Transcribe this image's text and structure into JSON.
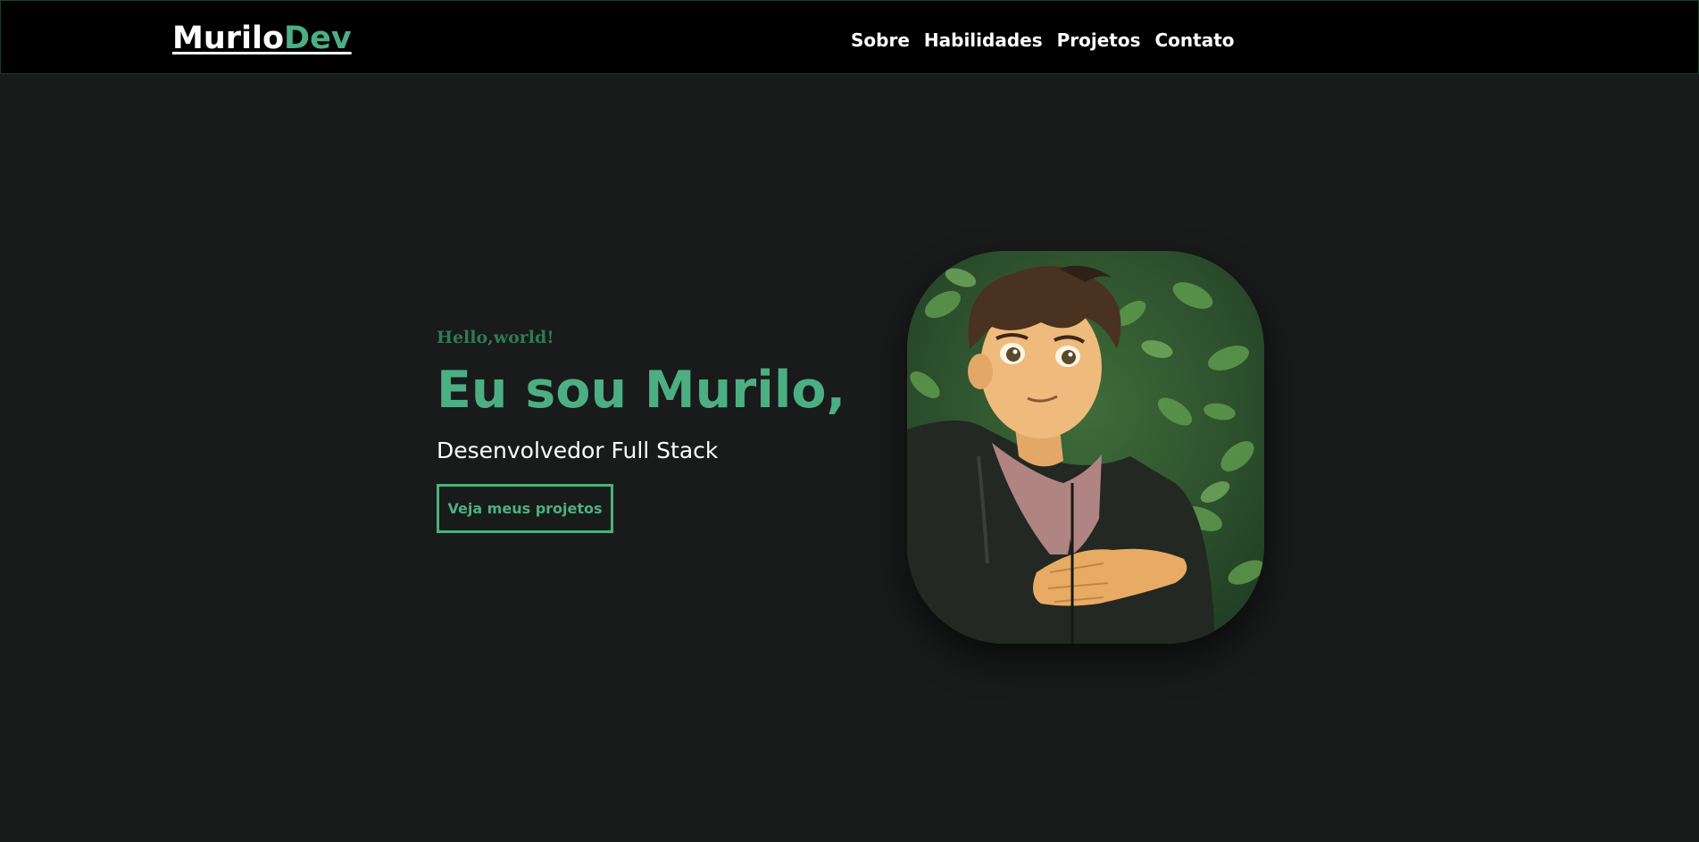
{
  "header": {
    "logo_main": "Murilo",
    "logo_accent": "Dev",
    "nav": [
      {
        "label": "Sobre"
      },
      {
        "label": "Habilidades"
      },
      {
        "label": "Projetos"
      },
      {
        "label": "Contato"
      }
    ]
  },
  "hero": {
    "greeting": "Hello,world!",
    "headline": "Eu sou Murilo,",
    "subtitle": "Desenvolvedor Full Stack",
    "cta_label": "Veja meus projetos",
    "portrait_alt": "avatar-illustration"
  },
  "colors": {
    "background": "#191a1a",
    "navbar": "#000000",
    "accent": "#4caf83",
    "greeting": "#2f7a55",
    "text": "#ffffff"
  }
}
